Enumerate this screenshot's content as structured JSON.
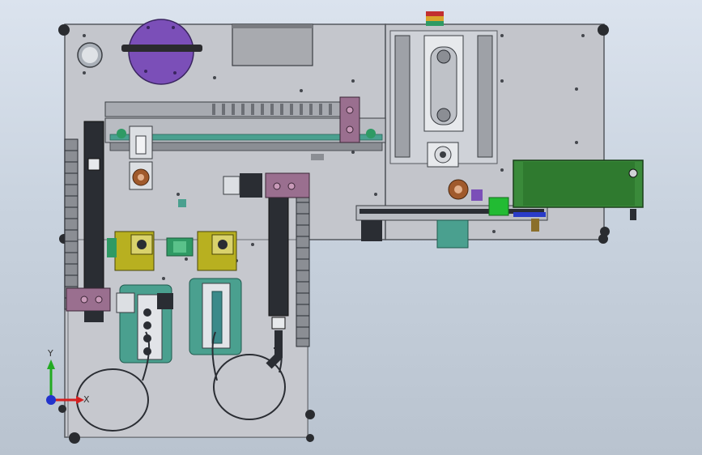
{
  "viewport": {
    "background_top": "#dbe3ee",
    "background_bottom": "#b9c3cf"
  },
  "triad": {
    "x_label": "X",
    "y_label": "Y",
    "x_color": "#d42020",
    "y_color": "#22aa22",
    "z_color": "#2233cc"
  },
  "colors": {
    "plate": "#c4c6cc",
    "plate_edge": "#55585e",
    "frame": "#cfd2d8",
    "rail": "#2a2d33",
    "green_part": "#2f9a64",
    "teal_part": "#4aa08f",
    "olive_part": "#b8b020",
    "pink_part": "#9a6f8f",
    "purple_part": "#7b4fb8",
    "bronze_part": "#a05a2c",
    "bright_green_part": "#22bb33",
    "pcb_green": "#3a8a3a",
    "blue_accent": "#2a3cc8"
  }
}
